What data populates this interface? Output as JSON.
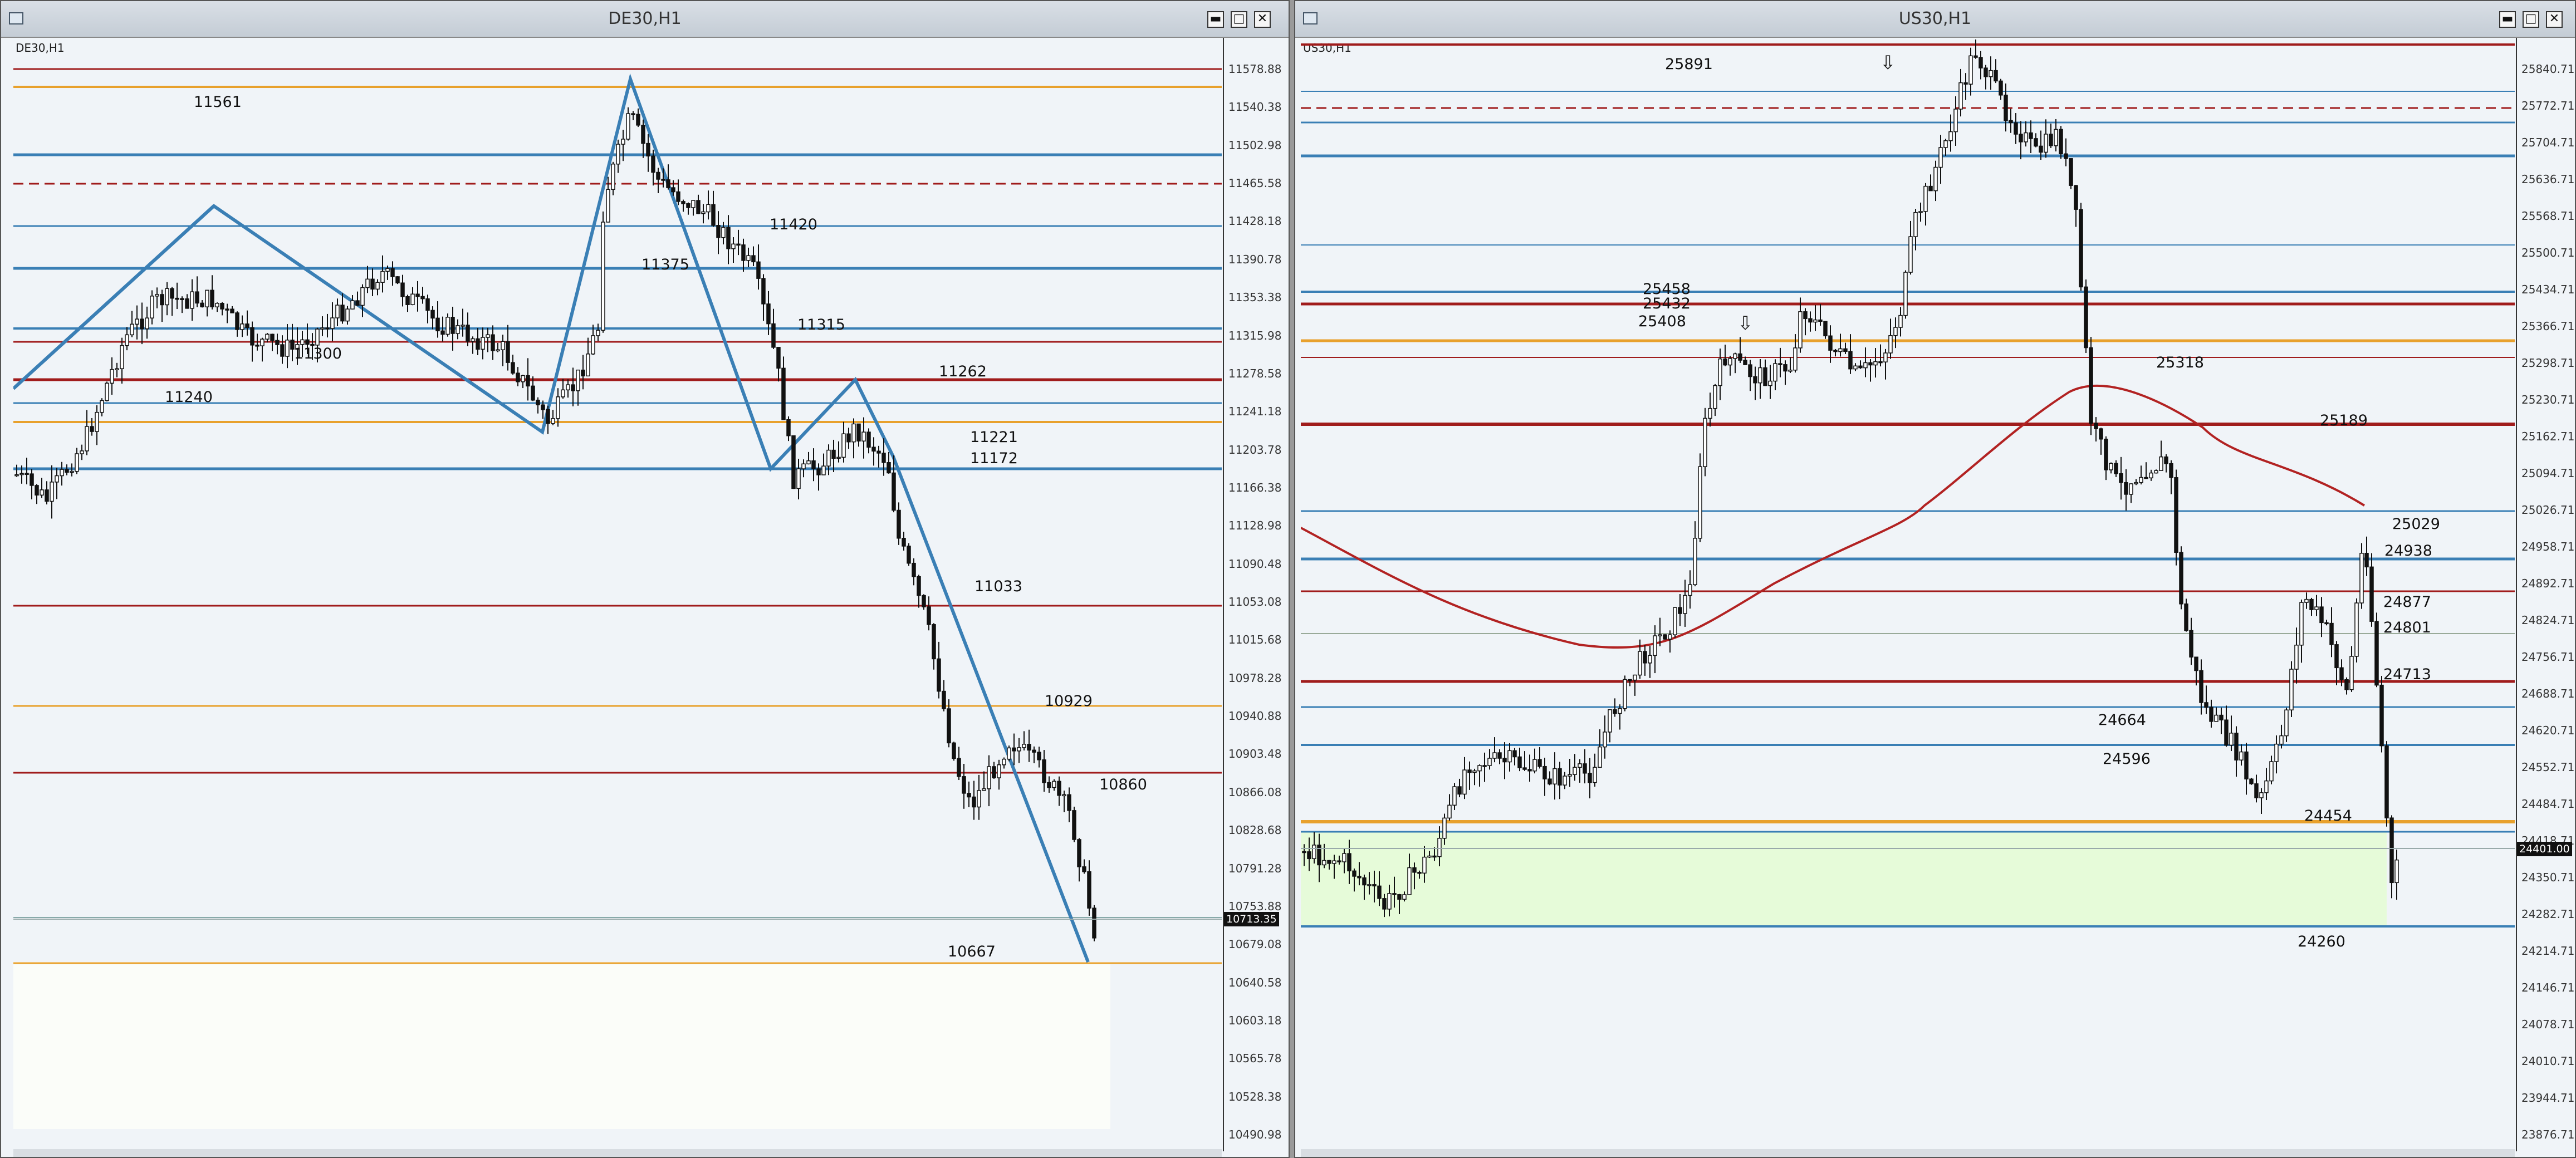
{
  "windows": {
    "de30": {
      "title": "DE30,H1",
      "symbol_tag": "DE30,H1",
      "price_axis": [
        "11578.88",
        "11540.38",
        "11502.98",
        "11465.58",
        "11428.18",
        "11390.78",
        "11353.38",
        "11315.98",
        "11278.58",
        "11241.18",
        "11203.78",
        "11166.38",
        "11128.98",
        "11090.48",
        "11053.08",
        "11015.68",
        "10978.28",
        "10940.88",
        "10903.48",
        "10866.08",
        "10828.68",
        "10791.28",
        "10753.88",
        "10679.08",
        "10640.58",
        "10603.18",
        "10565.78",
        "10528.38",
        "10490.98"
      ],
      "current_price": "10713.35",
      "level_labels": [
        "11561",
        "11420",
        "11375",
        "11315",
        "11300",
        "11262",
        "11240",
        "11221",
        "11172",
        "11033",
        "10929",
        "10860",
        "10667"
      ]
    },
    "us30": {
      "title": "US30,H1",
      "symbol_tag": "US30,H1",
      "price_axis": [
        "25840.71",
        "25772.71",
        "25704.71",
        "25636.71",
        "25568.71",
        "25500.71",
        "25434.71",
        "25366.71",
        "25298.71",
        "25230.71",
        "25162.71",
        "25094.71",
        "25026.71",
        "24958.71",
        "24892.71",
        "24824.71",
        "24756.71",
        "24688.71",
        "24620.71",
        "24552.71",
        "24484.71",
        "24418.71",
        "24350.71",
        "24282.71",
        "24214.71",
        "24146.71",
        "24078.71",
        "24010.71",
        "23944.71",
        "23876.71"
      ],
      "current_price": "24401.00",
      "level_labels": [
        "25891",
        "25458",
        "25432",
        "25408",
        "25318",
        "25189",
        "25029",
        "24938",
        "24877",
        "24801",
        "24713",
        "24664",
        "24596",
        "24454",
        "24260"
      ]
    }
  },
  "controls": {
    "minimize": "▬",
    "maximize": "□",
    "close": "✕"
  },
  "icons": {
    "window": "window-icon",
    "arrow": "down-arrow-icon"
  },
  "colors": {
    "blue": "#3a7fb5",
    "darkred": "#a01c1c",
    "orange": "#e8a12d",
    "ma": "#b22222",
    "candle": "#111111",
    "zone_green": "#e6fbd9",
    "zone_white": "#fbfdf9",
    "background": "#f0f4f8"
  }
}
